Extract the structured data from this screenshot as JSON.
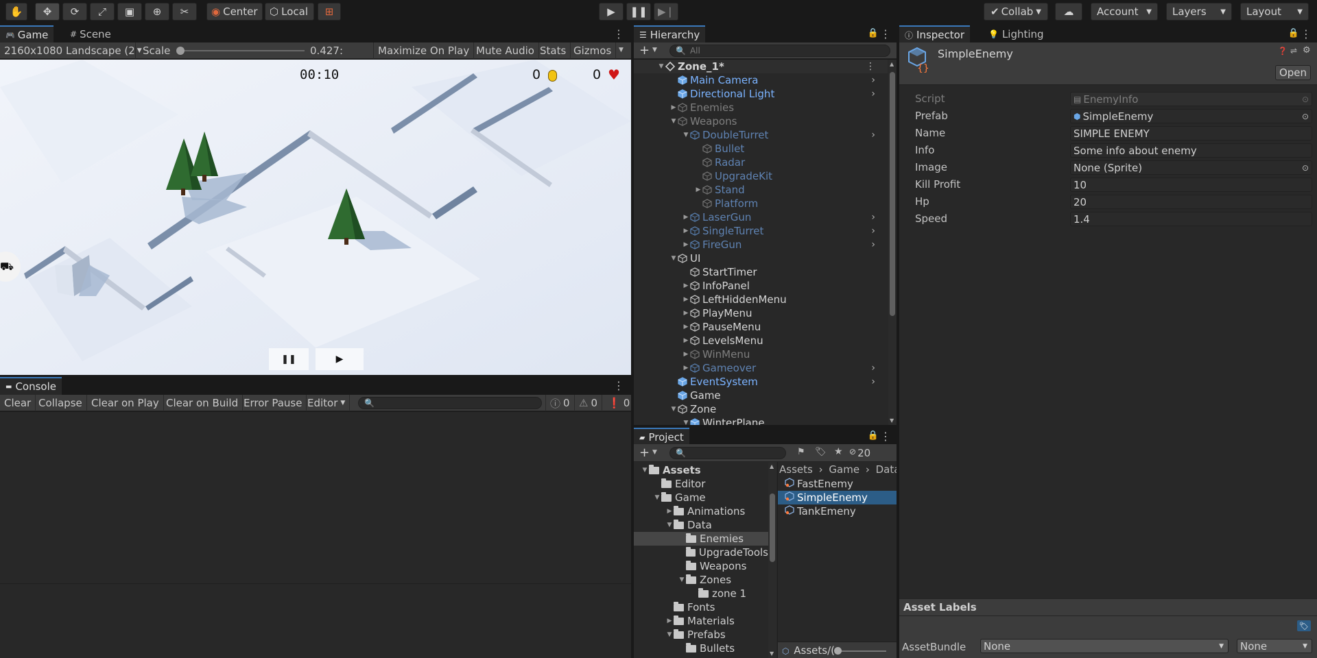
{
  "toolbar": {
    "center_label": "Center",
    "local_label": "Local",
    "collab_label": "Collab",
    "account_label": "Account",
    "layers_label": "Layers",
    "layout_label": "Layout"
  },
  "game_view": {
    "tabs": [
      "Game",
      "Scene"
    ],
    "resolution": "2160x1080 Landscape (2",
    "scale_label": "Scale",
    "scale_value": "0.427:",
    "maximize_label": "Maximize On Play",
    "mute_label": "Mute Audio",
    "stats_label": "Stats",
    "gizmos_label": "Gizmos",
    "hud_timer": "00:10",
    "hud_coins": "0",
    "hud_lives": "0"
  },
  "console": {
    "tab": "Console",
    "buttons": [
      "Clear",
      "Collapse",
      "Clear on Play",
      "Clear on Build",
      "Error Pause",
      "Editor"
    ],
    "counts": [
      "0",
      "0",
      "0"
    ]
  },
  "hierarchy": {
    "tab": "Hierarchy",
    "search_placeholder": "All",
    "items": [
      {
        "label": "Zone_1*",
        "depth": 0,
        "tri": "open",
        "style": "white",
        "icon": "scene",
        "arrow": false
      },
      {
        "label": "Main Camera",
        "depth": 1,
        "tri": "",
        "style": "blue",
        "icon": "cube-blue",
        "arrow": true
      },
      {
        "label": "Directional Light",
        "depth": 1,
        "tri": "",
        "style": "blue",
        "icon": "cube-blue",
        "arrow": true
      },
      {
        "label": "Enemies",
        "depth": 1,
        "tri": "closed",
        "style": "grayed",
        "icon": "cube-gray",
        "arrow": false
      },
      {
        "label": "Weapons",
        "depth": 1,
        "tri": "open",
        "style": "grayed",
        "icon": "cube-gray",
        "arrow": false
      },
      {
        "label": "DoubleTurret",
        "depth": 2,
        "tri": "open",
        "style": "faintblue",
        "icon": "cube-faint",
        "arrow": true
      },
      {
        "label": "Bullet",
        "depth": 3,
        "tri": "",
        "style": "faintblue",
        "icon": "cube-gray",
        "arrow": false
      },
      {
        "label": "Radar",
        "depth": 3,
        "tri": "",
        "style": "faintblue",
        "icon": "cube-gray",
        "arrow": false
      },
      {
        "label": "UpgradeKit",
        "depth": 3,
        "tri": "",
        "style": "faintblue",
        "icon": "cube-gray",
        "arrow": false
      },
      {
        "label": "Stand",
        "depth": 3,
        "tri": "closed",
        "style": "faintblue",
        "icon": "cube-gray",
        "arrow": false
      },
      {
        "label": "Platform",
        "depth": 3,
        "tri": "",
        "style": "faintblue",
        "icon": "cube-gray",
        "arrow": false
      },
      {
        "label": "LaserGun",
        "depth": 2,
        "tri": "closed",
        "style": "faintblue",
        "icon": "cube-faint",
        "arrow": true
      },
      {
        "label": "SingleTurret",
        "depth": 2,
        "tri": "closed",
        "style": "faintblue",
        "icon": "cube-faint",
        "arrow": true
      },
      {
        "label": "FireGun",
        "depth": 2,
        "tri": "closed",
        "style": "faintblue",
        "icon": "cube-faint",
        "arrow": true
      },
      {
        "label": "UI",
        "depth": 1,
        "tri": "open",
        "style": "white",
        "icon": "cube-white",
        "arrow": false
      },
      {
        "label": "StartTimer",
        "depth": 2,
        "tri": "",
        "style": "white",
        "icon": "cube-white",
        "arrow": false
      },
      {
        "label": "InfoPanel",
        "depth": 2,
        "tri": "closed",
        "style": "white",
        "icon": "cube-white",
        "arrow": false
      },
      {
        "label": "LeftHiddenMenu",
        "depth": 2,
        "tri": "closed",
        "style": "white",
        "icon": "cube-white",
        "arrow": false
      },
      {
        "label": "PlayMenu",
        "depth": 2,
        "tri": "closed",
        "style": "white",
        "icon": "cube-white",
        "arrow": false
      },
      {
        "label": "PauseMenu",
        "depth": 2,
        "tri": "closed",
        "style": "white",
        "icon": "cube-white",
        "arrow": false
      },
      {
        "label": "LevelsMenu",
        "depth": 2,
        "tri": "closed",
        "style": "white",
        "icon": "cube-white",
        "arrow": false
      },
      {
        "label": "WinMenu",
        "depth": 2,
        "tri": "closed",
        "style": "grayed",
        "icon": "cube-gray",
        "arrow": false
      },
      {
        "label": "Gameover",
        "depth": 2,
        "tri": "closed",
        "style": "faintblue",
        "icon": "cube-faint",
        "arrow": true
      },
      {
        "label": "EventSystem",
        "depth": 1,
        "tri": "",
        "style": "blue",
        "icon": "cube-blue",
        "arrow": true
      },
      {
        "label": "Game",
        "depth": 1,
        "tri": "",
        "style": "white",
        "icon": "cube-blue",
        "arrow": false
      },
      {
        "label": "Zone",
        "depth": 1,
        "tri": "open",
        "style": "white",
        "icon": "cube-white",
        "arrow": false
      },
      {
        "label": "WinterPlane",
        "depth": 2,
        "tri": "open",
        "style": "white",
        "icon": "cube-blue",
        "arrow": false
      }
    ]
  },
  "project": {
    "tab": "Project",
    "hidden_count": "20",
    "tree": [
      {
        "label": "Assets",
        "depth": 0,
        "tri": "open",
        "bold": true
      },
      {
        "label": "Editor",
        "depth": 1,
        "tri": ""
      },
      {
        "label": "Game",
        "depth": 1,
        "tri": "open"
      },
      {
        "label": "Animations",
        "depth": 2,
        "tri": "closed"
      },
      {
        "label": "Data",
        "depth": 2,
        "tri": "open"
      },
      {
        "label": "Enemies",
        "depth": 3,
        "tri": "",
        "selected": true
      },
      {
        "label": "UpgradeTools",
        "depth": 3,
        "tri": ""
      },
      {
        "label": "Weapons",
        "depth": 3,
        "tri": ""
      },
      {
        "label": "Zones",
        "depth": 3,
        "tri": "open"
      },
      {
        "label": "zone 1",
        "depth": 4,
        "tri": ""
      },
      {
        "label": "Fonts",
        "depth": 2,
        "tri": ""
      },
      {
        "label": "Materials",
        "depth": 2,
        "tri": "closed"
      },
      {
        "label": "Prefabs",
        "depth": 2,
        "tri": "open"
      },
      {
        "label": "Bullets",
        "depth": 3,
        "tri": ""
      }
    ],
    "breadcrumb": [
      "Assets",
      "Game",
      "Data"
    ],
    "files": [
      {
        "label": "FastEnemy",
        "selected": false
      },
      {
        "label": "SimpleEnemy",
        "selected": true
      },
      {
        "label": "TankEmeny",
        "selected": false
      }
    ],
    "path_label": "Assets/("
  },
  "inspector": {
    "tabs": [
      "Inspector",
      "Lighting"
    ],
    "object_name": "SimpleEnemy",
    "open_label": "Open",
    "fields": [
      {
        "label": "Script",
        "value": "EnemyInfo",
        "disabled": true,
        "icon": "script",
        "target": true
      },
      {
        "label": "Prefab",
        "value": "SimpleEnemy",
        "disabled": false,
        "icon": "cube",
        "target": true
      },
      {
        "label": "Name",
        "value": "SIMPLE ENEMY",
        "disabled": false,
        "icon": "",
        "target": false
      },
      {
        "label": "Info",
        "value": "Some info about enemy",
        "disabled": false,
        "icon": "",
        "target": false
      },
      {
        "label": "Image",
        "value": "None (Sprite)",
        "disabled": false,
        "icon": "",
        "target": true
      },
      {
        "label": "Kill Profit",
        "value": "10",
        "disabled": false,
        "icon": "",
        "target": false
      },
      {
        "label": "Hp",
        "value": "20",
        "disabled": false,
        "icon": "",
        "target": false
      },
      {
        "label": "Speed",
        "value": "1.4",
        "disabled": false,
        "icon": "",
        "target": false
      }
    ],
    "asset_labels_title": "Asset Labels",
    "assetbundle_label": "AssetBundle",
    "assetbundle_value": "None",
    "assetbundle_variant": "None"
  },
  "colors": {
    "accent": "#3a79bb",
    "selection": "#2c5d87",
    "prefab_blue": "#7bb3ff",
    "snow": "#e8eef8"
  }
}
